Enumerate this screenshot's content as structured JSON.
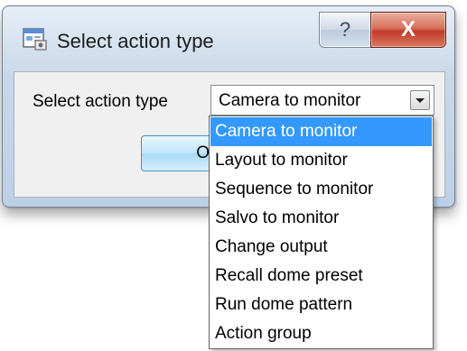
{
  "window": {
    "title": "Select action type",
    "help_label": "?",
    "close_label": "X"
  },
  "form": {
    "field_label": "Select action type",
    "combo_value": "Camera to monitor",
    "ok_label": "OK"
  },
  "dropdown": {
    "items": [
      {
        "label": "Camera to monitor",
        "selected": true
      },
      {
        "label": "Layout to monitor",
        "selected": false
      },
      {
        "label": "Sequence to monitor",
        "selected": false
      },
      {
        "label": "Salvo to monitor",
        "selected": false
      },
      {
        "label": "Change output",
        "selected": false
      },
      {
        "label": "Recall dome preset",
        "selected": false
      },
      {
        "label": "Run dome pattern",
        "selected": false
      },
      {
        "label": "Action group",
        "selected": false
      }
    ]
  },
  "colors": {
    "selection": "#3399ff",
    "close_button": "#c2392a"
  }
}
